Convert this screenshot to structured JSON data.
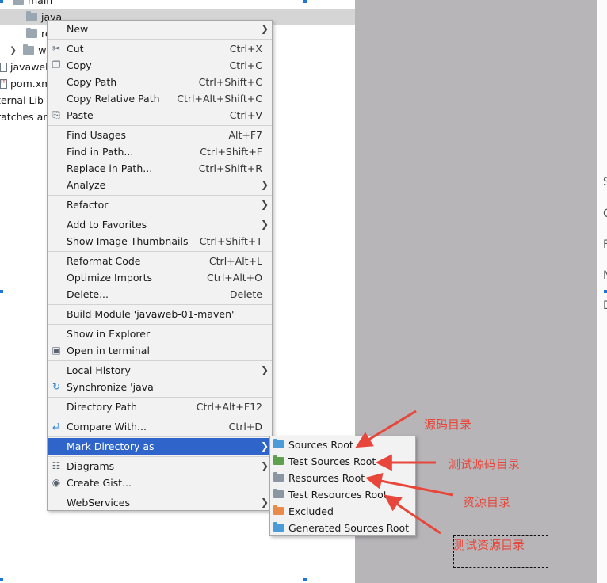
{
  "tree": {
    "rows": [
      {
        "label": "main",
        "kind": "folder"
      },
      {
        "label": "java",
        "kind": "folder"
      },
      {
        "label": "re",
        "kind": "folder"
      },
      {
        "label": "w",
        "kind": "folder"
      },
      {
        "label": "javaweb",
        "kind": "file"
      },
      {
        "label": "pom.xm",
        "kind": "file"
      },
      {
        "label": "ternal Lib",
        "kind": "text"
      },
      {
        "label": "ratches ar",
        "kind": "text"
      }
    ]
  },
  "editor_edge_chars": [
    "S",
    "C",
    "F",
    "N",
    "D"
  ],
  "menu": {
    "items": [
      {
        "label": "New",
        "shortcut": "",
        "submenu": true,
        "icon": ""
      },
      {
        "label": "Cut",
        "shortcut": "Ctrl+X",
        "submenu": false,
        "icon": "scissors-icon"
      },
      {
        "label": "Copy",
        "shortcut": "Ctrl+C",
        "submenu": false,
        "icon": "copy-icon"
      },
      {
        "label": "Copy Path",
        "shortcut": "Ctrl+Shift+C",
        "submenu": false,
        "icon": ""
      },
      {
        "label": "Copy Relative Path",
        "shortcut": "Ctrl+Alt+Shift+C",
        "submenu": false,
        "icon": ""
      },
      {
        "label": "Paste",
        "shortcut": "Ctrl+V",
        "submenu": false,
        "icon": "paste-icon"
      },
      {
        "label": "Find Usages",
        "shortcut": "Alt+F7",
        "submenu": false,
        "icon": ""
      },
      {
        "label": "Find in Path...",
        "shortcut": "Ctrl+Shift+F",
        "submenu": false,
        "icon": ""
      },
      {
        "label": "Replace in Path...",
        "shortcut": "Ctrl+Shift+R",
        "submenu": false,
        "icon": ""
      },
      {
        "label": "Analyze",
        "shortcut": "",
        "submenu": true,
        "icon": ""
      },
      {
        "label": "Refactor",
        "shortcut": "",
        "submenu": true,
        "icon": ""
      },
      {
        "label": "Add to Favorites",
        "shortcut": "",
        "submenu": true,
        "icon": ""
      },
      {
        "label": "Show Image Thumbnails",
        "shortcut": "Ctrl+Shift+T",
        "submenu": false,
        "icon": ""
      },
      {
        "label": "Reformat Code",
        "shortcut": "Ctrl+Alt+L",
        "submenu": false,
        "icon": ""
      },
      {
        "label": "Optimize Imports",
        "shortcut": "Ctrl+Alt+O",
        "submenu": false,
        "icon": ""
      },
      {
        "label": "Delete...",
        "shortcut": "Delete",
        "submenu": false,
        "icon": ""
      },
      {
        "label": "Build Module 'javaweb-01-maven'",
        "shortcut": "",
        "submenu": false,
        "icon": ""
      },
      {
        "label": "Show in Explorer",
        "shortcut": "",
        "submenu": false,
        "icon": ""
      },
      {
        "label": "Open in terminal",
        "shortcut": "",
        "submenu": false,
        "icon": "terminal-icon"
      },
      {
        "label": "Local History",
        "shortcut": "",
        "submenu": true,
        "icon": ""
      },
      {
        "label": "Synchronize 'java'",
        "shortcut": "",
        "submenu": false,
        "icon": "sync-icon"
      },
      {
        "label": "Directory Path",
        "shortcut": "Ctrl+Alt+F12",
        "submenu": false,
        "icon": ""
      },
      {
        "label": "Compare With...",
        "shortcut": "Ctrl+D",
        "submenu": false,
        "icon": "compare-icon"
      },
      {
        "label": "Mark Directory as",
        "shortcut": "",
        "submenu": true,
        "icon": "",
        "active": true
      },
      {
        "label": "Diagrams",
        "shortcut": "",
        "submenu": true,
        "icon": "diagram-icon"
      },
      {
        "label": "Create Gist...",
        "shortcut": "",
        "submenu": false,
        "icon": "github-icon"
      },
      {
        "label": "WebServices",
        "shortcut": "",
        "submenu": true,
        "icon": ""
      }
    ]
  },
  "submenu": {
    "items": [
      {
        "label": "Sources Root",
        "color": "#4a9bd8"
      },
      {
        "label": "Test Sources Root",
        "color": "#5fa04e"
      },
      {
        "label": "Resources Root",
        "color": "#8a96a2"
      },
      {
        "label": "Test Resources Root",
        "color": "#8a96a2"
      },
      {
        "label": "Excluded",
        "color": "#e88b4a"
      },
      {
        "label": "Generated Sources Root",
        "color": "#4a9bd8"
      }
    ]
  },
  "annotations": {
    "a1": "源码目录",
    "a2": "测试源码目录",
    "a3": "资源目录",
    "a4": "测试资源目录",
    "color": "#e8463a"
  }
}
